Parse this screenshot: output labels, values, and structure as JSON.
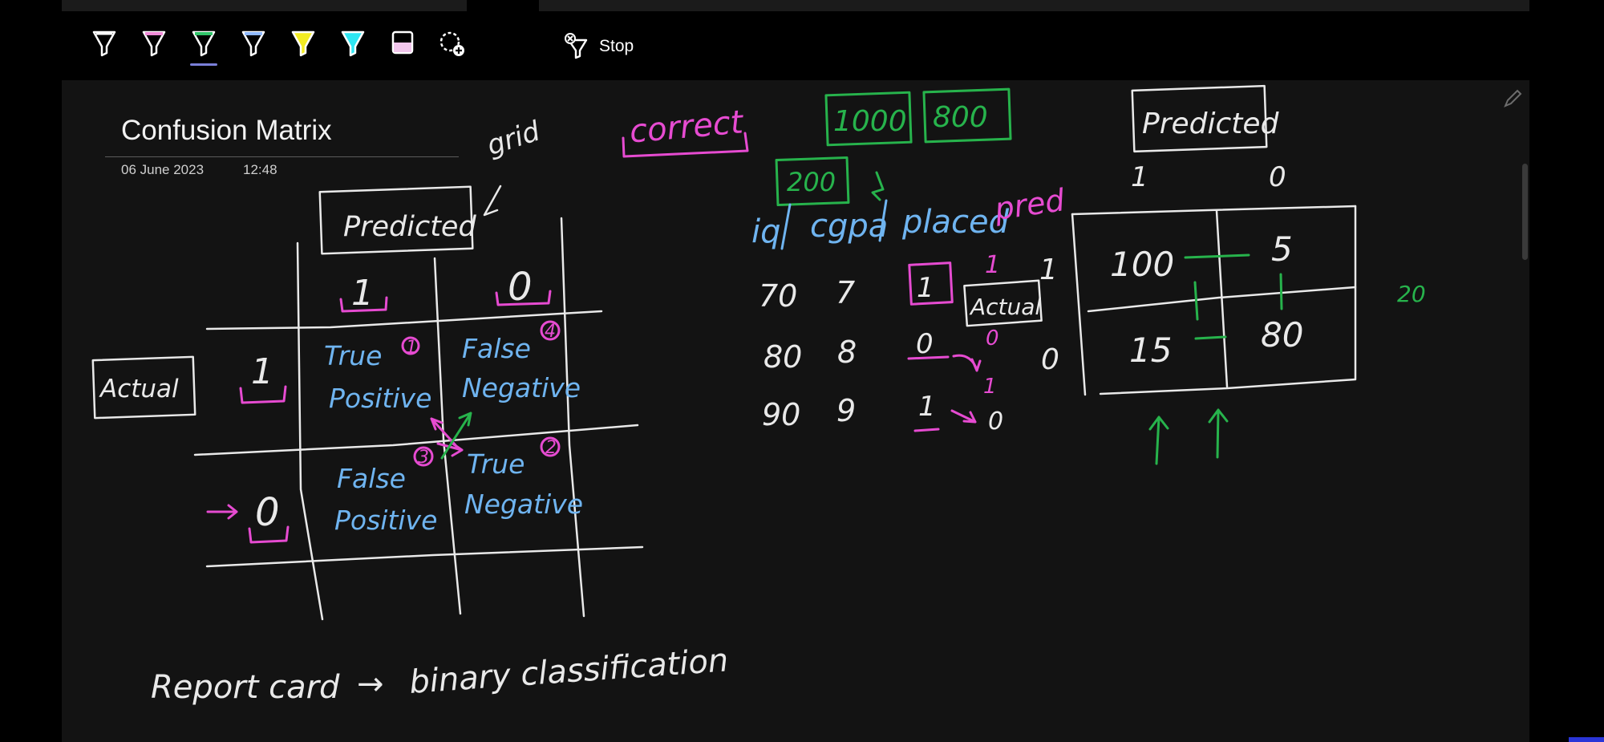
{
  "toolbar": {
    "tools": [
      {
        "name": "white-pen-icon",
        "color": "#ffffff"
      },
      {
        "name": "pink-pen-icon",
        "color": "#f08bd8"
      },
      {
        "name": "green-pen-icon",
        "color": "#31c56a"
      },
      {
        "name": "blue-pen-icon",
        "color": "#8fb9ff"
      },
      {
        "name": "yellow-highlighter-icon",
        "color": "#f3ec24"
      },
      {
        "name": "cyan-highlighter-icon",
        "color": "#2ee6f2"
      },
      {
        "name": "eraser-icon",
        "color": "#f2c6ec"
      },
      {
        "name": "lasso-select-icon",
        "color": "#ffffff"
      }
    ],
    "stop_label": "Stop"
  },
  "page": {
    "title": "Confusion Matrix",
    "date": "06 June 2023",
    "time": "12:48"
  },
  "ink": {
    "colors": {
      "white": "#e9e9e9",
      "pink": "#e64bd1",
      "blue": "#6fb4f0",
      "green": "#27b34c"
    },
    "left_matrix": {
      "grid_note": "grid",
      "predicted": "Predicted",
      "actual": "Actual",
      "col_1": "1",
      "col_0": "0",
      "row_1": "1",
      "row_0": "0",
      "tp_word1": "True",
      "tp_word2": "Positive",
      "tp_num": "1",
      "fn_word1": "False",
      "fn_word2": "Negative",
      "fn_num": "4",
      "fp_word1": "False",
      "fp_word2": "Positive",
      "fp_num": "3",
      "tn_word1": "True",
      "tn_word2": "Negative",
      "tn_num": "2"
    },
    "note": {
      "left": "Report card",
      "arrow": "→",
      "right": "binary classification"
    },
    "correct": "correct",
    "totals": {
      "total": "1000",
      "correct": "800",
      "wrong": "200"
    },
    "table": {
      "headers": [
        "iq",
        "cgpa",
        "placed",
        "pred"
      ],
      "rows": [
        {
          "iq": "70",
          "cgpa": "7",
          "placed": "1",
          "pred": "1"
        },
        {
          "iq": "80",
          "cgpa": "8",
          "placed": "0",
          "pred": "0"
        },
        {
          "iq": "90",
          "cgpa": "9",
          "placed": "1",
          "pred": "0"
        }
      ],
      "actual_label": "Actual",
      "row_labels": [
        "1",
        "0"
      ],
      "pred_top": [
        "1",
        "1"
      ]
    },
    "right_matrix": {
      "predicted": "Predicted",
      "col_1": "1",
      "col_0": "0",
      "tp": "100",
      "fn": "5",
      "fp": "15",
      "tn": "80",
      "side_note": "20"
    }
  }
}
